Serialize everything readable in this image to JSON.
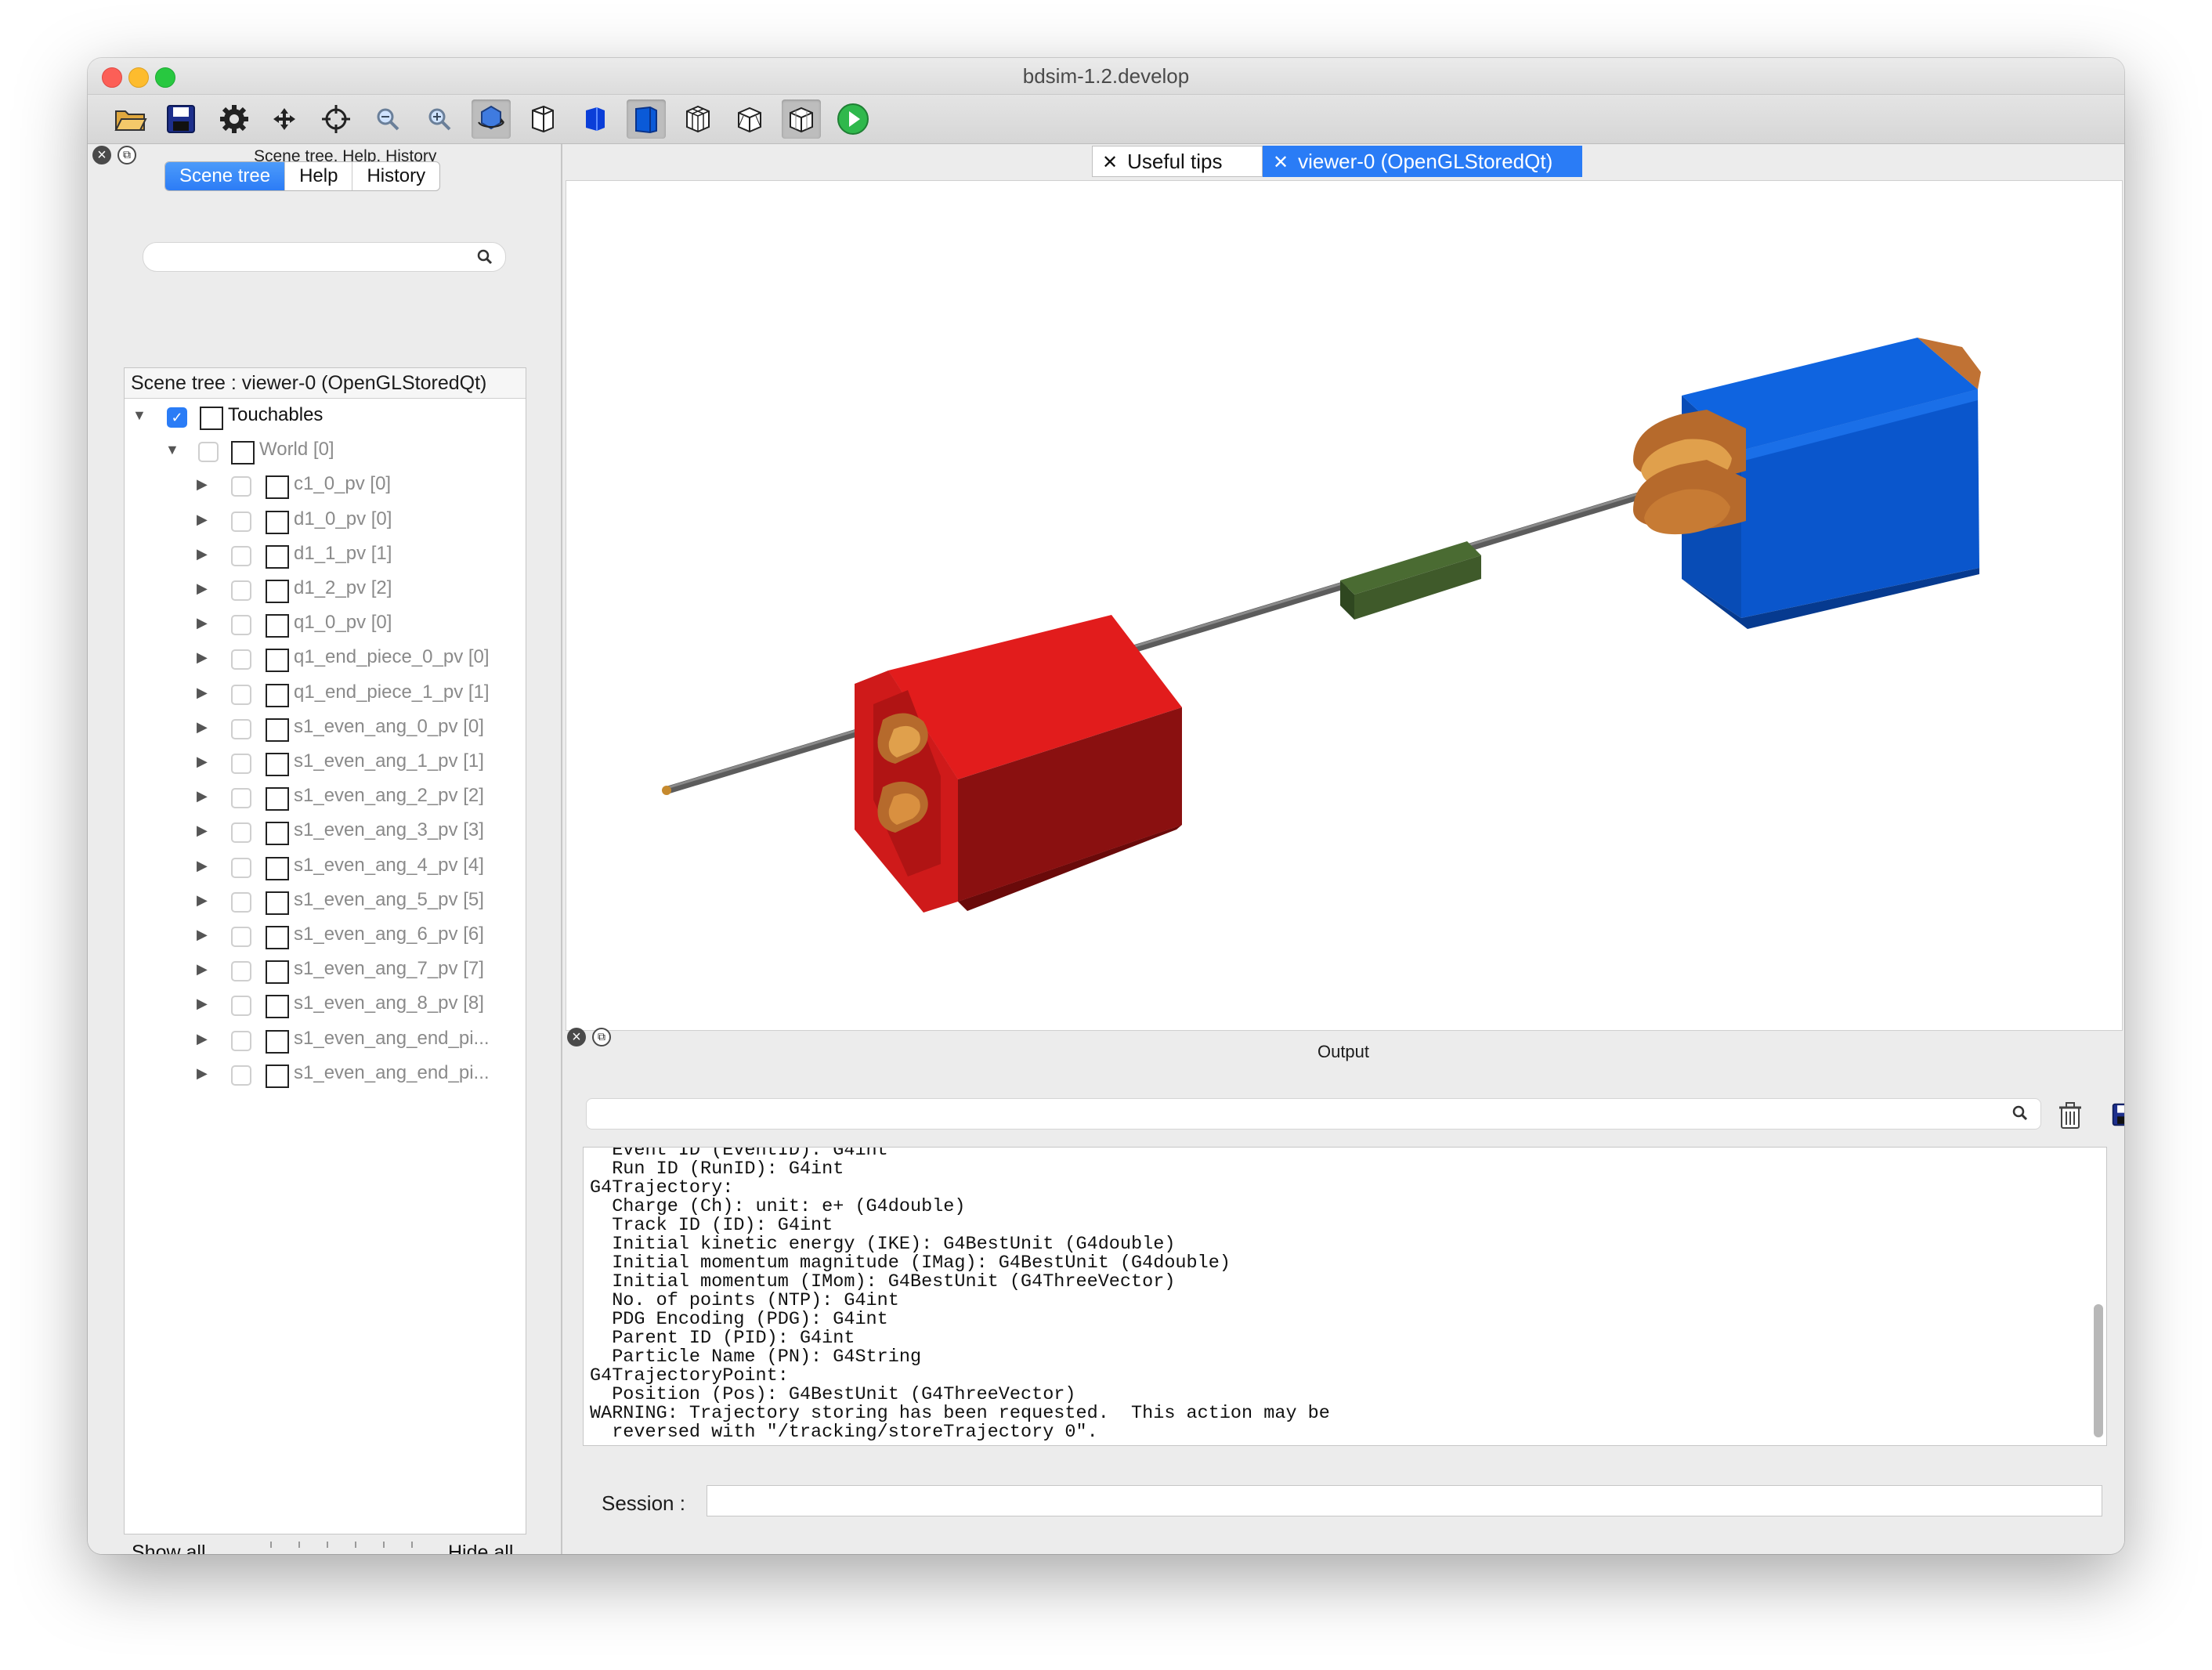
{
  "window": {
    "title": "bdsim-1.2.develop"
  },
  "toolbar": {
    "icons": [
      "open-folder-icon",
      "save-icon",
      "settings-gear-icon",
      "move-icon",
      "pick-crosshair-icon",
      "zoom-out-icon",
      "zoom-in-icon",
      "rotate-icon",
      "wireframe-box-icon",
      "solid-box-icon",
      "surface-box-icon",
      "hidden-line-icon",
      "hidden-surface-icon",
      "cube-outline-icon",
      "run-play-icon"
    ]
  },
  "left_dock": {
    "title": "Scene tree, Help, History",
    "tabs": [
      "Scene tree",
      "Help",
      "History"
    ],
    "active_tab": "Scene tree",
    "search_placeholder": "",
    "tree_header": "Scene tree : viewer-0 (OpenGLStoredQt)",
    "rows": [
      {
        "label": "Touchables",
        "checked": true,
        "expanded": true,
        "level": 0
      },
      {
        "label": "World [0]",
        "checked": false,
        "expanded": true,
        "level": 1
      },
      {
        "label": "c1_0_pv [0]",
        "checked": false,
        "level": 2
      },
      {
        "label": "d1_0_pv [0]",
        "checked": false,
        "level": 2
      },
      {
        "label": "d1_1_pv [1]",
        "checked": false,
        "level": 2
      },
      {
        "label": "d1_2_pv [2]",
        "checked": false,
        "level": 2
      },
      {
        "label": "q1_0_pv [0]",
        "checked": false,
        "level": 2
      },
      {
        "label": "q1_end_piece_0_pv [0]",
        "checked": false,
        "level": 2
      },
      {
        "label": "q1_end_piece_1_pv [1]",
        "checked": false,
        "level": 2
      },
      {
        "label": "s1_even_ang_0_pv [0]",
        "checked": false,
        "level": 2
      },
      {
        "label": "s1_even_ang_1_pv [1]",
        "checked": false,
        "level": 2
      },
      {
        "label": "s1_even_ang_2_pv [2]",
        "checked": false,
        "level": 2
      },
      {
        "label": "s1_even_ang_3_pv [3]",
        "checked": false,
        "level": 2
      },
      {
        "label": "s1_even_ang_4_pv [4]",
        "checked": false,
        "level": 2
      },
      {
        "label": "s1_even_ang_5_pv [5]",
        "checked": false,
        "level": 2
      },
      {
        "label": "s1_even_ang_6_pv [6]",
        "checked": false,
        "level": 2
      },
      {
        "label": "s1_even_ang_7_pv [7]",
        "checked": false,
        "level": 2
      },
      {
        "label": "s1_even_ang_8_pv [8]",
        "checked": false,
        "level": 2
      },
      {
        "label": "s1_even_ang_end_pi...",
        "checked": false,
        "level": 2
      },
      {
        "label": "s1_even_ang_end_pi...",
        "checked": false,
        "level": 2
      }
    ],
    "show_all": "Show all",
    "hide_all": "Hide all"
  },
  "viewer_tabs": [
    {
      "label": "Useful tips",
      "active": false
    },
    {
      "label": "viewer-0 (OpenGLStoredQt)",
      "active": true
    }
  ],
  "scene_colors": {
    "dipole": "#d81c1c",
    "quadrupole": "#0a5ad8",
    "pipe": "#666666",
    "drift_element": "#3f5a2a",
    "coil": "#b66a2c"
  },
  "output": {
    "title": "Output",
    "search_placeholder": "",
    "lines": "  Event ID (EventID): G4int\n  Run ID (RunID): G4int\nG4Trajectory:\n  Charge (Ch): unit: e+ (G4double)\n  Track ID (ID): G4int\n  Initial kinetic energy (IKE): G4BestUnit (G4double)\n  Initial momentum magnitude (IMag): G4BestUnit (G4double)\n  Initial momentum (IMom): G4BestUnit (G4ThreeVector)\n  No. of points (NTP): G4int\n  PDG Encoding (PDG): G4int\n  Parent ID (PID): G4int\n  Particle Name (PN): G4String\nG4TrajectoryPoint:\n  Position (Pos): G4BestUnit (G4ThreeVector)\nWARNING: Trajectory storing has been requested.  This action may be\n  reversed with \"/tracking/storeTrajectory 0\".",
    "session_label": "Session :",
    "session_value": ""
  }
}
